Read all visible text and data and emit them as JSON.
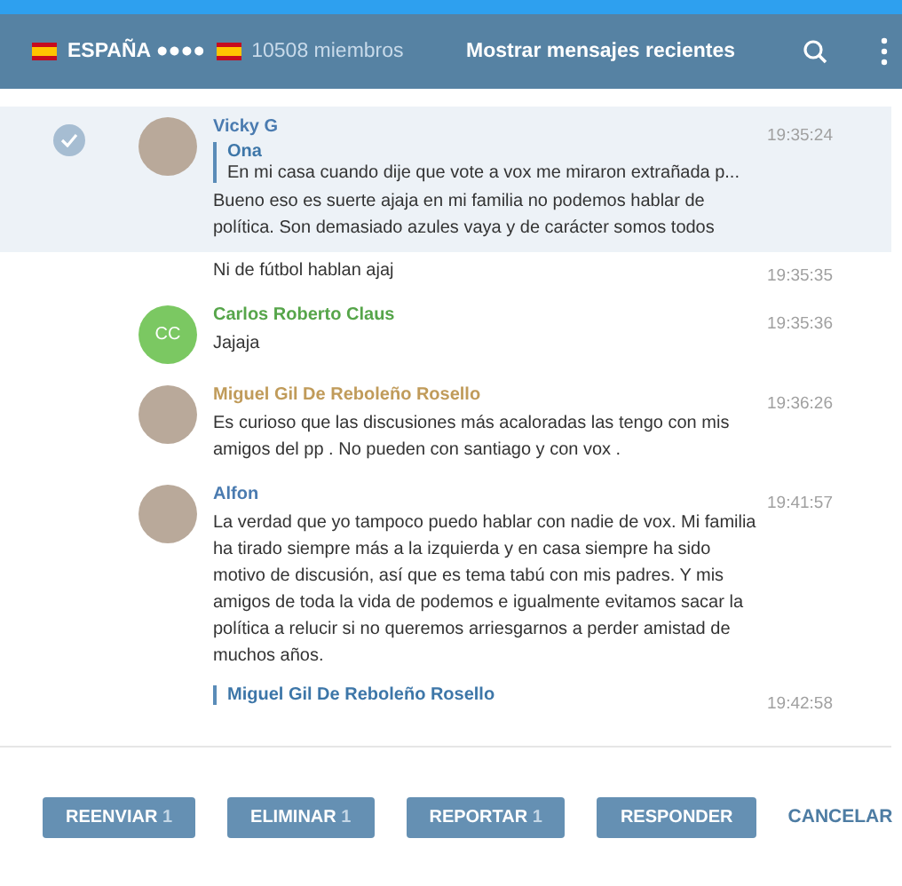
{
  "header": {
    "title": "ESPAÑA ●●●●",
    "members": "10508 miembros",
    "recent_link": "Mostrar mensajes recientes"
  },
  "messages": [
    {
      "kind": "message",
      "selected": true,
      "author": "Vicky G",
      "color": "#4a7bb0",
      "avatar": {
        "kind": "photo"
      },
      "time": "19:35:24",
      "reply": {
        "author": "Ona",
        "text": "En mi casa cuando dije que vote a vox me miraron extrañada p..."
      },
      "text": "Bueno eso es suerte ajaja en mi familia no podemos hablar de política. Son demasiado azules vaya y de carácter somos todos"
    },
    {
      "kind": "continuation",
      "selected": false,
      "time": "19:35:35",
      "text": "Ni de fútbol hablan ajaj"
    },
    {
      "kind": "message",
      "selected": false,
      "author": "Carlos Roberto Claus",
      "color": "#56a54a",
      "avatar": {
        "kind": "initials",
        "initials": "CC",
        "color": "#7bc862"
      },
      "time": "19:35:36",
      "text": "Jajaja"
    },
    {
      "kind": "message",
      "selected": false,
      "author": "Miguel Gil De Reboleño Rosello",
      "color": "#c09b5a",
      "avatar": {
        "kind": "photo"
      },
      "time": "19:36:26",
      "text": "Es curioso que las discusiones más acaloradas las tengo con mis amigos del pp . No pueden con santiago y con vox ."
    },
    {
      "kind": "message",
      "selected": false,
      "author": "Alfon",
      "color": "#4a7bb0",
      "avatar": {
        "kind": "photo"
      },
      "time": "19:41:57",
      "text": "La verdad que yo tampoco puedo hablar con nadie de vox. Mi familia ha tirado siempre más a la izquierda y en casa siempre ha sido motivo de discusión, así que es tema tabú con mis padres. Y mis amigos de toda la vida de podemos e igualmente evitamos sacar la política a relucir si no queremos arriesgarnos a perder amistad de muchos años."
    },
    {
      "kind": "continuation",
      "selected": false,
      "time": "19:42:58",
      "reply": {
        "author": "Miguel Gil De Reboleño Rosello"
      }
    }
  ],
  "actions": [
    {
      "label": "REENVIAR",
      "count": "1"
    },
    {
      "label": "ELIMINAR",
      "count": "1"
    },
    {
      "label": "REPORTAR",
      "count": "1"
    },
    {
      "label": "RESPONDER"
    }
  ],
  "cancel": "CANCELAR"
}
